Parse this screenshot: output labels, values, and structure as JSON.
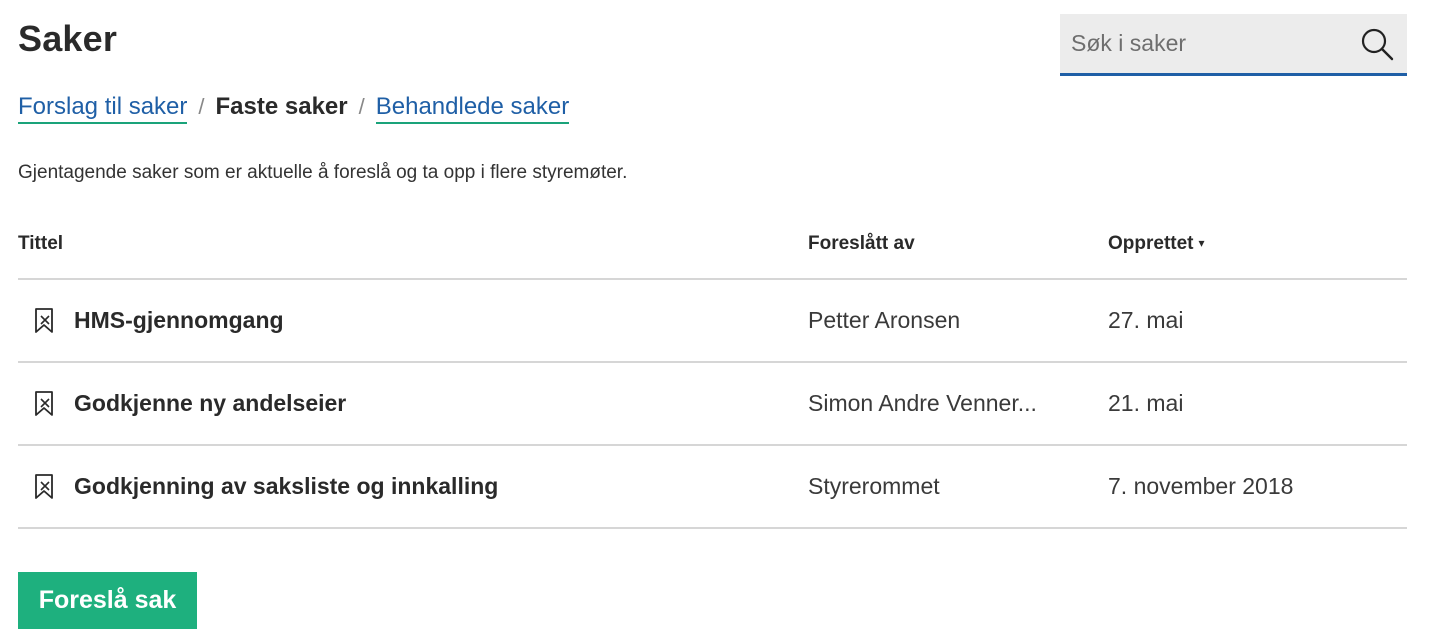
{
  "header": {
    "title": "Saker"
  },
  "search": {
    "placeholder": "Søk i saker",
    "value": "",
    "icon": "search-icon"
  },
  "breadcrumb": {
    "items": [
      {
        "label": "Forslag til saker",
        "active": false
      },
      {
        "label": "Faste saker",
        "active": true
      },
      {
        "label": "Behandlede saker",
        "active": false
      }
    ],
    "separator": "/"
  },
  "description": "Gjentagende saker som er aktuelle å foreslå og ta opp i flere styremøter.",
  "table": {
    "columns": {
      "title": "Tittel",
      "proposed_by": "Foreslått av",
      "created": "Opprettet",
      "sort_indicator": "▾"
    },
    "rows": [
      {
        "icon": "bookmark-recurring-icon",
        "title": "HMS-gjennomgang",
        "proposed_by": "Petter Aronsen",
        "created": "27. mai"
      },
      {
        "icon": "bookmark-recurring-icon",
        "title": "Godkjenne ny andelseier",
        "proposed_by": "Simon Andre Venner...",
        "created": "21. mai"
      },
      {
        "icon": "bookmark-recurring-icon",
        "title": "Godkjenning av saksliste og innkalling",
        "proposed_by": "Styrerommet",
        "created": "7. november 2018"
      }
    ]
  },
  "actions": {
    "propose_label": "Foreslå sak"
  },
  "colors": {
    "link": "#1f5fa6",
    "link_underline": "#1aa37a",
    "primary_button": "#1eb07e",
    "search_bg": "#ececec",
    "divider": "#d6d6d6"
  }
}
